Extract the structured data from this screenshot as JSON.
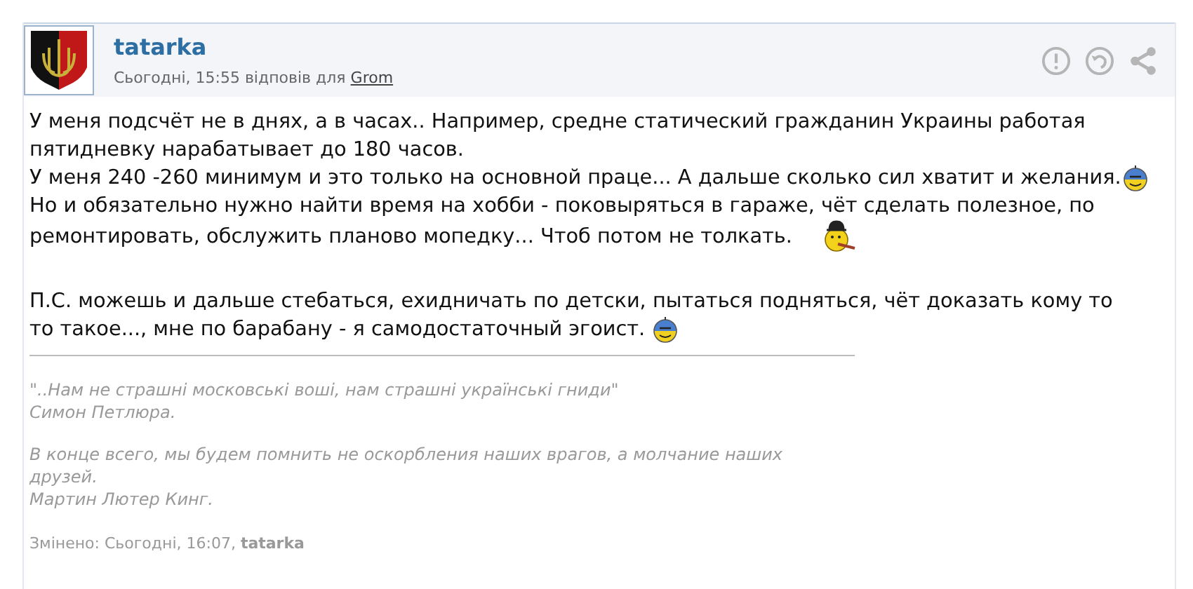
{
  "post": {
    "author": "tatarka",
    "meta": {
      "time": "Сьогодні, 15:55 відповів для",
      "reply_to": "Grom"
    },
    "actions": [
      {
        "kind": "report"
      },
      {
        "kind": "reply"
      },
      {
        "kind": "share"
      }
    ],
    "paragraphs": [
      {
        "lines": [
          "У меня подсчёт не в днях, а в часах.. Например, средне статический гражданин Украины работая",
          "пятидневку нарабатывает до 180 часов."
        ]
      },
      {
        "lines": [
          "У меня 240 -260 минимум и это только на основной праце... А дальше сколько сил хватит и желания."
        ],
        "emoticon": {
          "kind": "flag"
        }
      },
      {
        "lines": [
          "Но и обязательно нужно найти время на хобби - поковыряться в гараже, чёт сделать полезное, по",
          "ремонтировать, обслужить планово мопедку... Чтоб потом не толкать."
        ],
        "emoticon": {
          "kind": "hat"
        }
      },
      {
        "lines": [
          "П.С. можешь и дальше стебаться, ехидничать по детски, пытаться подняться, чёт доказать кому то",
          "то такое..., мне по барабану - я самодостаточный эгоист."
        ],
        "emoticon": {
          "kind": "flag"
        }
      }
    ],
    "signature": [
      [
        "\"..Нам не страшні московські воші, нам страшні українські гниди\"",
        "Симон Петлюра."
      ],
      [
        "В конце всего, мы будем помнить не оскорбления наших врагов, а молчание наших друзей.",
        "Мартин Лютер Кинг."
      ]
    ],
    "edited": {
      "label": "Змінено: Сьогодні, 16:07,",
      "by": "tatarka"
    }
  }
}
